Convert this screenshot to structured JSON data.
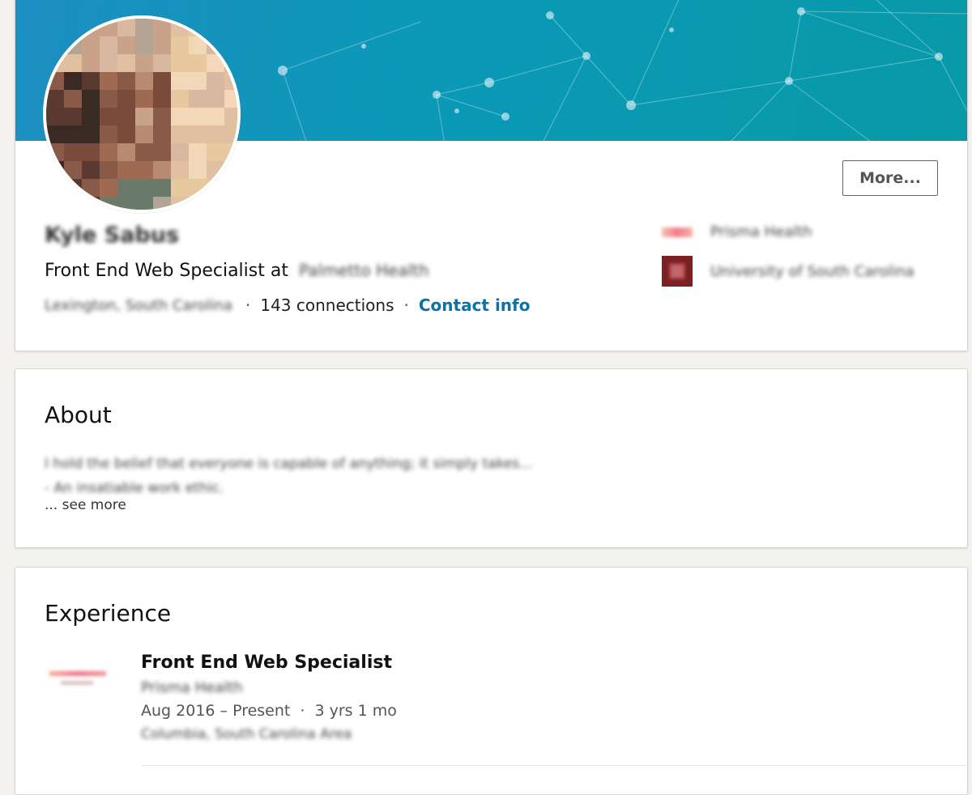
{
  "colors": {
    "page_background": "#f3f2ef",
    "banner_start": "#1d8fc2",
    "banner_end": "#089aa8",
    "link": "#0b73a8"
  },
  "profile": {
    "name": "Kyle Sabus",
    "headline_prefix": "Front End Web Specialist at",
    "headline_company": "Palmetto Health",
    "location": "Lexington, South Carolina",
    "connections": "143 connections",
    "contact_info": "Contact info",
    "more_button": "More...",
    "current_employer": "Prisma Health",
    "education": "University of South Carolina",
    "separator": "·"
  },
  "about": {
    "title": "About",
    "line1": "I hold the belief that everyone is capable of anything; it simply takes...",
    "line2": "- An insatiable work ethic.",
    "see_more": "... see more"
  },
  "experience": {
    "title": "Experience",
    "items": [
      {
        "role": "Front End Web Specialist",
        "company": "Prisma Health",
        "dates": "Aug 2016 – Present",
        "duration": "3 yrs 1 mo",
        "location": "Columbia, South Carolina Area"
      }
    ]
  },
  "icons": {
    "avatar": "profile-photo-pixelated",
    "employer_logo": "employer-logo",
    "school_logo": "school-logo"
  }
}
